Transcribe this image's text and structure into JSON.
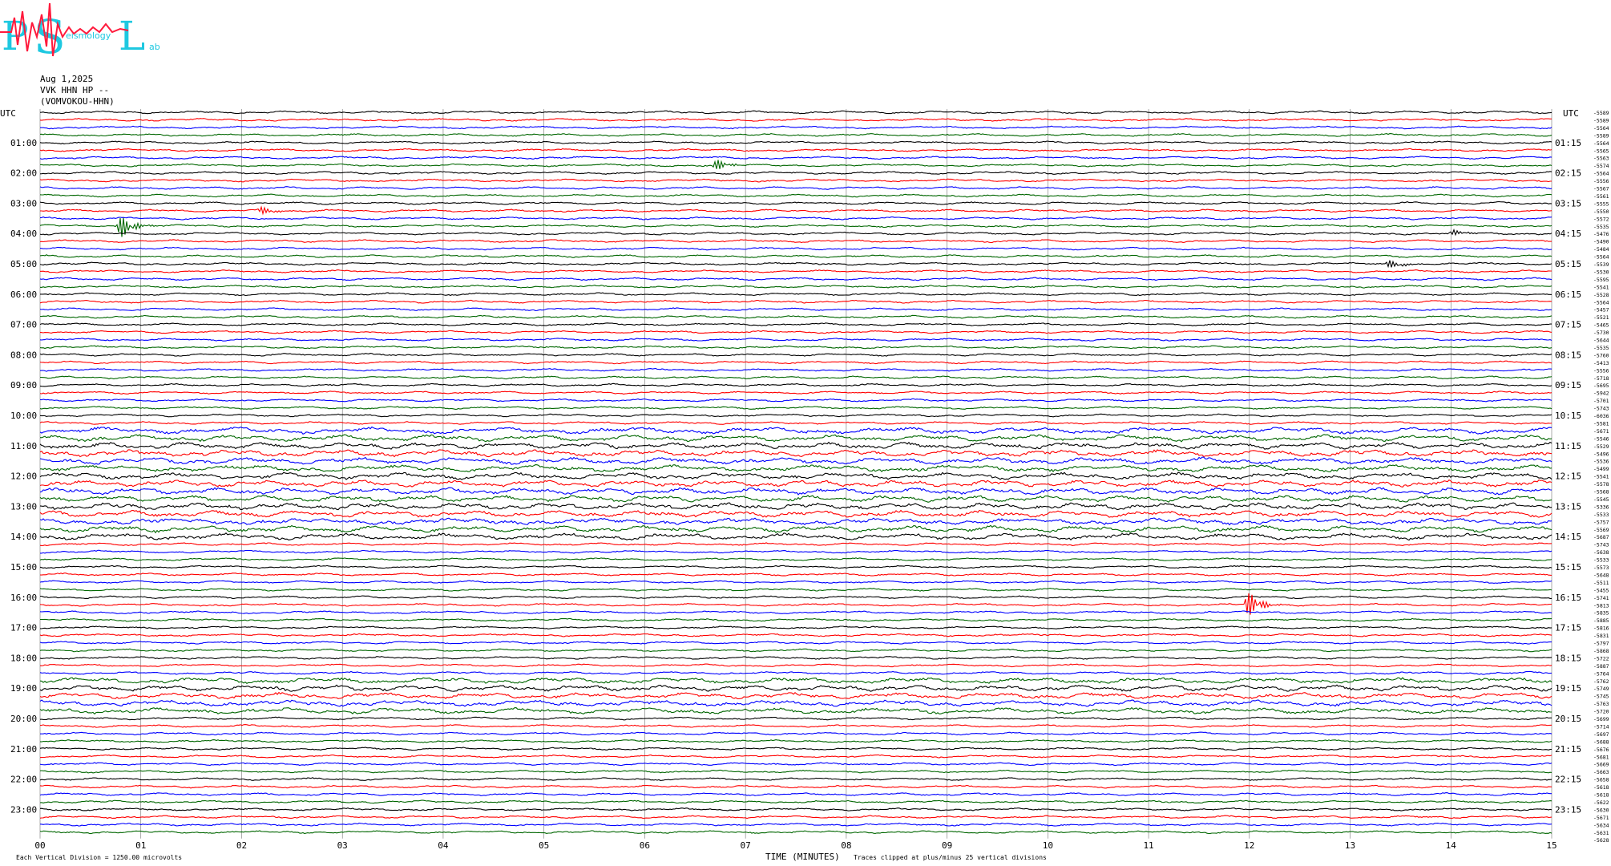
{
  "header": {
    "logo_text": "PSL",
    "logo_subtext_1": "eismology",
    "logo_subtext_2": "ab",
    "date": "Aug 1,2025",
    "channel": "VVK HHN HP --",
    "station": "(VOMVOKOU-HHN)"
  },
  "colors": {
    "trace_cycle": [
      "#000000",
      "#ff0000",
      "#0000ff",
      "#006600"
    ],
    "gridline": "#000000",
    "logo_cyan": "#1ec8e0",
    "logo_red": "#ff1a3c"
  },
  "chart_data": {
    "type": "line",
    "title": "",
    "xlabel": "TIME (MINUTES)",
    "left_axis_label": "UTC",
    "right_axis_label": "UTC",
    "x_ticks": [
      "00",
      "01",
      "02",
      "03",
      "04",
      "05",
      "06",
      "07",
      "08",
      "09",
      "10",
      "11",
      "12",
      "13",
      "14",
      "15"
    ],
    "xlim": [
      0,
      15
    ],
    "rows_per_hour": 4,
    "row_count": 96,
    "left_hour_labels": [
      "01:00",
      "02:00",
      "03:00",
      "04:00",
      "05:00",
      "06:00",
      "07:00",
      "08:00",
      "09:00",
      "10:00",
      "11:00",
      "12:00",
      "13:00",
      "14:00",
      "15:00",
      "16:00",
      "17:00",
      "18:00",
      "19:00",
      "20:00",
      "21:00",
      "22:00",
      "23:00"
    ],
    "right_hour_labels": [
      "01:15",
      "02:15",
      "03:15",
      "04:15",
      "05:15",
      "06:15",
      "07:15",
      "08:15",
      "09:15",
      "10:15",
      "11:15",
      "12:15",
      "13:15",
      "14:15",
      "15:15",
      "16:15",
      "17:15",
      "18:15",
      "19:15",
      "20:15",
      "21:15",
      "22:15",
      "23:15"
    ],
    "trace_offsets": [
      "-5589",
      "-5589",
      "-5564",
      "-5589",
      "-5564",
      "-5565",
      "-5563",
      "-5574",
      "-5564",
      "-5556",
      "-5567",
      "-5561",
      "-5555",
      "-5550",
      "-5572",
      "-5535",
      "-5476",
      "-5490",
      "-5484",
      "-5564",
      "-5539",
      "-5530",
      "-5595",
      "-5541",
      "-5528",
      "-5564",
      "-5457",
      "-5521",
      "-5465",
      "-5730",
      "-5644",
      "-5535",
      "-5760",
      "-5413",
      "-5556",
      "-5718",
      "-5695",
      "-5942",
      "-5701",
      "-5743",
      "-6036",
      "-5581",
      "-5671",
      "-5546",
      "-5529",
      "-5496",
      "-5536",
      "-5499",
      "-5541",
      "-5578",
      "-5568",
      "-5545",
      "-5336",
      "-5533",
      "-5757",
      "-5569",
      "-5687",
      "-5743",
      "-5638",
      "-5533",
      "-5573",
      "-5648",
      "-5511",
      "-5455",
      "-5741",
      "-5813",
      "-5835",
      "-5885",
      "-5816",
      "-5831",
      "-5797",
      "-5868",
      "-5722",
      "-5887",
      "-5764",
      "-5762",
      "-5749",
      "-5745",
      "-5763",
      "-5720",
      "-5699",
      "-5714",
      "-5697",
      "-5688",
      "-5676",
      "-5681",
      "-5669",
      "-5663",
      "-5658",
      "-5618",
      "-5618",
      "-5622",
      "-5630",
      "-5671",
      "-5634",
      "-5631",
      "-5628"
    ],
    "events": [
      {
        "row": 7,
        "minute": 6.7,
        "series_color": "#0000ff",
        "amplitude": 2.5
      },
      {
        "row": 15,
        "minute": 0.8,
        "series_color": "#ff0000",
        "amplitude": 5
      },
      {
        "row": 13,
        "minute": 2.2,
        "series_color": "#0000ff",
        "amplitude": 1.5
      },
      {
        "row": 65,
        "minute": 12.0,
        "series_color": "#ff0000",
        "amplitude": 5
      },
      {
        "row": 20,
        "minute": 13.4,
        "series_color": "#006600",
        "amplitude": 1.5
      },
      {
        "row": 16,
        "minute": 14.0,
        "series_color": "#ff0000",
        "amplitude": 1.5
      }
    ],
    "noisy_rows": [
      {
        "from": 42,
        "to": 56,
        "amplitude": 2.2
      },
      {
        "from": 75,
        "to": 79,
        "amplitude": 2.0
      }
    ],
    "grid": true
  },
  "footer": {
    "scale_note": "Each Vertical Division = 1250.00 microvolts",
    "x_caption": "TIME (MINUTES)",
    "clip_note": "Traces clipped at plus/minus 25 vertical divisions"
  }
}
